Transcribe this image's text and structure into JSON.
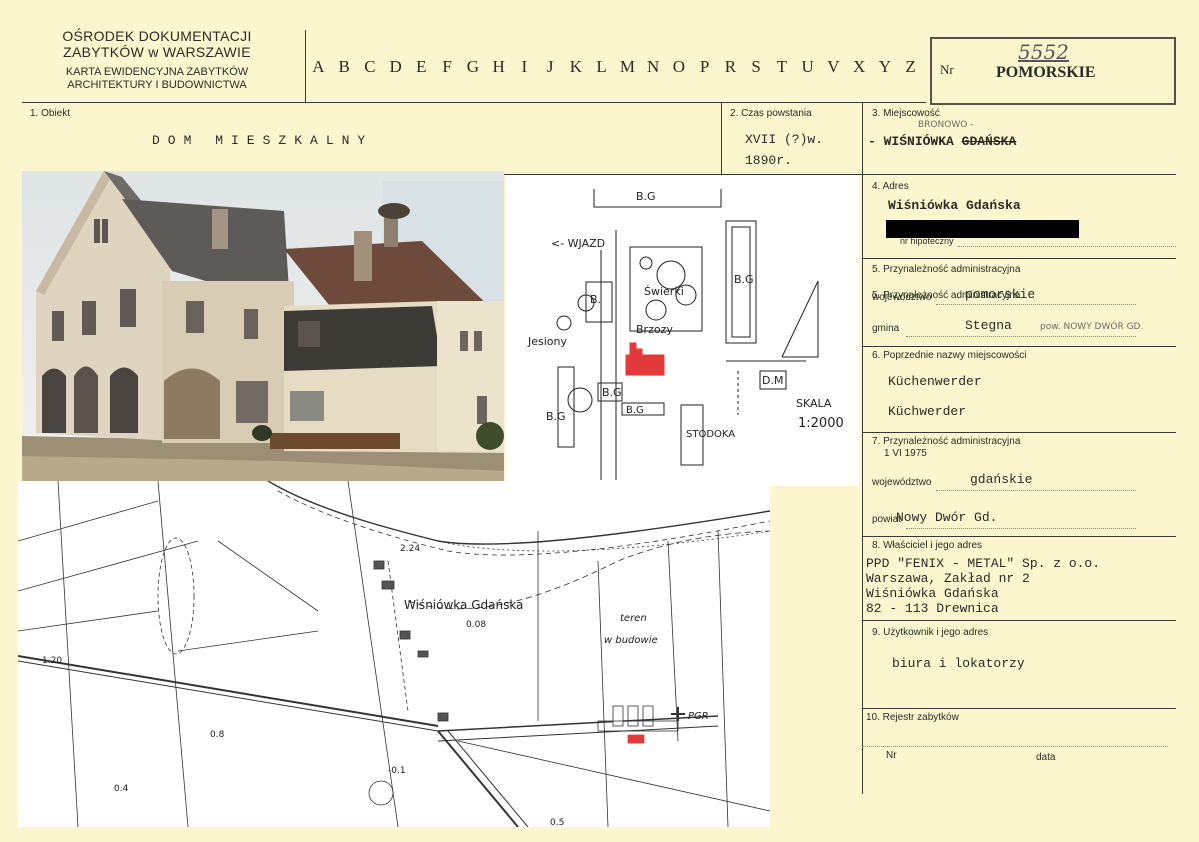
{
  "header": {
    "institution_line1": "OŚRODEK DOKUMENTACJI",
    "institution_line2": "ZABYTKÓW w WARSZAWIE",
    "card_line1": "KARTA EWIDENCYJNA ZABYTKÓW",
    "card_line2": "ARCHITEKTURY I BUDOWNICTWA",
    "letters": [
      "A",
      "B",
      "C",
      "D",
      "E",
      "F",
      "G",
      "H",
      "I",
      "J",
      "K",
      "L",
      "M",
      "N",
      "O",
      "P",
      "R",
      "S",
      "T",
      "U",
      "V",
      "X",
      "Y",
      "Z"
    ],
    "nr_label": "Nr",
    "nr_value": "5552",
    "region": "POMORSKIE"
  },
  "fields": {
    "obiekt": {
      "label": "1. Obiekt",
      "value": "DOM MIESZKALNY"
    },
    "czas": {
      "label": "2. Czas powstania",
      "line1": "XVII (?)w.",
      "line2": "1890r."
    },
    "miejscowosc": {
      "label": "3. Miejscowość",
      "handwritten": "BRONOWO -",
      "value_dash": "-",
      "value": "WIŚNIÓWKA",
      "value_struck": "GDAŃSKA"
    },
    "adres": {
      "label": "4. Adres",
      "value": "Wiśniówka Gdańska",
      "sub_label": "nr hipoteczny"
    },
    "przynaleznosc": {
      "label": "5. Przynależność administracyjna",
      "woj_label": "województwo",
      "woj_value": "pomorskie",
      "gmina_label": "gmina",
      "gmina_value": "Stegna",
      "gmina_hand": "pow. NOWY DWÓR GD."
    },
    "poprzednie": {
      "label": "6. Poprzednie nazwy miejscowości",
      "name1": "Küchenwerder",
      "name2": "Küchwerder"
    },
    "przynaleznosc_1975": {
      "label": "7. Przynależność administracyjna",
      "date": "1 VI 1975",
      "woj_label": "województwo",
      "woj_value": "gdańskie",
      "powiat_label": "powiat",
      "powiat_value": "Nowy Dwór Gd."
    },
    "wlasciciel": {
      "label": "8. Właściciel i jego adres",
      "line1": "PPD \"FENIX - METAL\"  Sp. z o.o.",
      "line2": "Warszawa, Zakład nr 2",
      "line3": "Wiśniówka Gdańska",
      "line4": "82 - 113 Drewnica"
    },
    "uzytkownik": {
      "label": "9. Użytkownik i jego adres",
      "value": "biura i lokatorzy"
    },
    "rejestr": {
      "label": "10. Rejestr zabytków",
      "nr_label": "Nr",
      "data_label": "data"
    }
  },
  "sketch": {
    "bg_top": "B.G",
    "wjazd": "<- WJAZD",
    "bg_right": "B.G",
    "b_left": "B.",
    "swierki": "Świerki",
    "jesiony": "Jesiony",
    "brzozy": "Brzozy",
    "dm": "D.M",
    "skala": "SKALA",
    "skala_value": "1:2000",
    "bg_left": "B.G",
    "bg_small": "B.G",
    "bg_bottom": "B.G",
    "stodoka": "STODOKA"
  },
  "map": {
    "place": "Wiśniówka Gdańska",
    "teren": "teren",
    "w_budowie": "w budowie",
    "pgr": "PGR",
    "h224": "2.24",
    "h008": "0.08",
    "h120": "1.20",
    "h08": "0.8",
    "h04": "0.4",
    "h01": "-0.1",
    "h05": "0.5"
  },
  "colors": {
    "paper": "#fcf6cf",
    "ink": "#2b2a26",
    "mark_red": "#e23a3a"
  }
}
